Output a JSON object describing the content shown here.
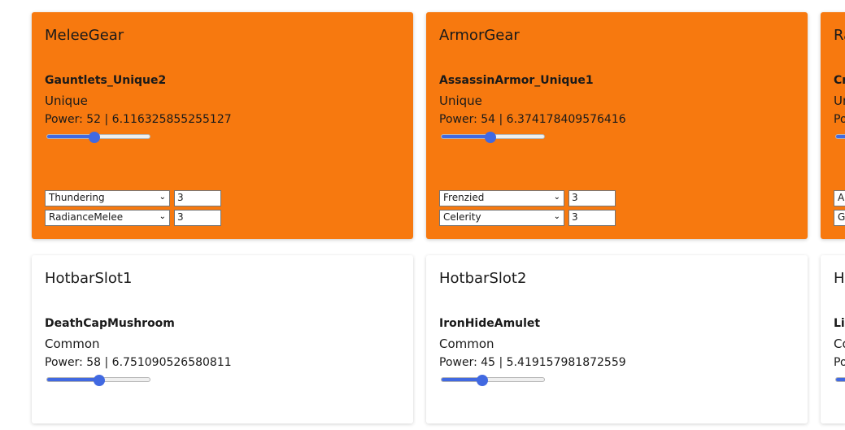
{
  "cards": [
    {
      "slot": "MeleeGear",
      "item": "Gauntlets_Unique2",
      "rarity": "Unique",
      "power_text": "Power: 52 | 6.116325855255127",
      "power_fraction": 0.46,
      "enchantments": [
        {
          "name": "Thundering",
          "level": "3"
        },
        {
          "name": "RadianceMelee",
          "level": "3"
        }
      ]
    },
    {
      "slot": "ArmorGear",
      "item": "AssassinArmor_Unique1",
      "rarity": "Unique",
      "power_text": "Power: 54 | 6.374178409576416",
      "power_fraction": 0.48,
      "enchantments": [
        {
          "name": "Frenzied",
          "level": "3"
        },
        {
          "name": "Celerity",
          "level": "3"
        }
      ]
    },
    {
      "slot": "Ra",
      "item": "Cr",
      "rarity": "Un",
      "power_text": "Po",
      "power_fraction": 0.5,
      "enchantments": [
        {
          "name": "A",
          "level": ""
        },
        {
          "name": "G",
          "level": ""
        }
      ]
    },
    {
      "slot": "HotbarSlot1",
      "item": "DeathCapMushroom",
      "rarity": "Common",
      "power_text": "Power: 58 | 6.751090526580811",
      "power_fraction": 0.51,
      "enchantments": []
    },
    {
      "slot": "HotbarSlot2",
      "item": "IronHideAmulet",
      "rarity": "Common",
      "power_text": "Power: 45 | 5.419157981872559",
      "power_fraction": 0.4,
      "enchantments": []
    },
    {
      "slot": "H",
      "item": "Li",
      "rarity": "Co",
      "power_text": "Po",
      "power_fraction": 0.5,
      "enchantments": []
    }
  ],
  "colors": {
    "gear_card": "#f7790f",
    "hotbar_card": "#ffffff",
    "slider_accent": "#4169e1"
  },
  "icons": {
    "dropdown": "chevron-down-icon"
  }
}
